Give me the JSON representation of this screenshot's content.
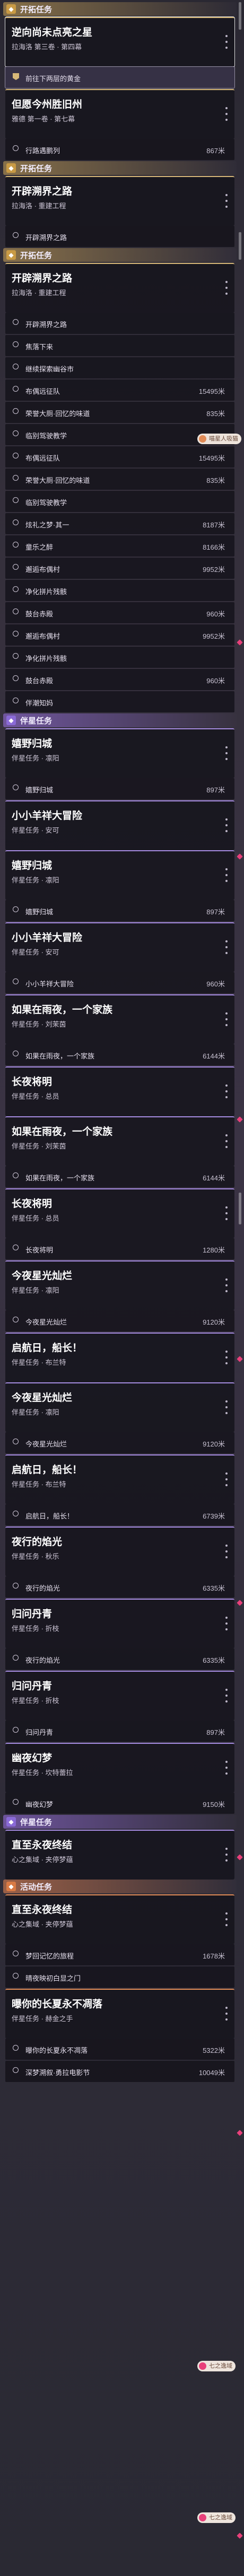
{
  "ui": {
    "more_icon": "more-vertical-icon",
    "bullet_icon": "circle-outline-icon",
    "flag_icon": "quest-flag-icon",
    "accent_colors": {
      "trailblaze": "#d7b878",
      "companion": "#a58be0",
      "event": "#e08a55",
      "marker": "#e8407a"
    }
  },
  "floating_tags": [
    {
      "label": "喵星人吸猫",
      "variant": "orange"
    },
    {
      "label": "七之逸域",
      "variant": "pink"
    },
    {
      "label": "七之逸域",
      "variant": "pink"
    }
  ],
  "feed": [
    {
      "kind": "header",
      "cat": "trail",
      "label": "开拓任务"
    },
    {
      "kind": "card",
      "cat": "trail",
      "title": "逆向尚未点亮之星",
      "sub": "拉海洛 第三卷 · 第四幕"
    },
    {
      "kind": "step",
      "text": "前往下两层的黄金",
      "dist": "",
      "bullet": "flag",
      "hl": true
    },
    {
      "kind": "card",
      "cat": "trail",
      "title": "但愿今州胜旧州",
      "sub": "雅德 第一卷 · 第七幕"
    },
    {
      "kind": "step",
      "text": "行路遇鹏列",
      "dist": "867米"
    },
    {
      "kind": "header",
      "cat": "trail",
      "label": "开拓任务"
    },
    {
      "kind": "card",
      "cat": "trail",
      "title": "开辟溯界之路",
      "sub": "拉海洛 · 重建工程"
    },
    {
      "kind": "step",
      "text": "开辟溯界之路",
      "dist": ""
    },
    {
      "kind": "header",
      "cat": "trail",
      "label": "开拓任务"
    },
    {
      "kind": "card",
      "cat": "trail",
      "title": "开辟溯界之路",
      "sub": "拉海洛 · 重建工程"
    },
    {
      "kind": "step",
      "text": "开辟溯界之路",
      "dist": ""
    },
    {
      "kind": "step",
      "text": "焦落下来",
      "dist": ""
    },
    {
      "kind": "step",
      "text": "继续探索幽谷市",
      "dist": ""
    },
    {
      "kind": "step",
      "text": "布偶远征队",
      "dist": "15495米"
    },
    {
      "kind": "step",
      "text": "荣誉大厕·回忆的味道",
      "dist": "835米"
    },
    {
      "kind": "step",
      "text": "临别驾驶教学",
      "dist": ""
    },
    {
      "kind": "step",
      "text": "布偶远征队",
      "dist": "15495米"
    },
    {
      "kind": "step",
      "text": "荣誉大厕·回忆的味道",
      "dist": "835米"
    },
    {
      "kind": "step",
      "text": "临别驾驶教学",
      "dist": ""
    },
    {
      "kind": "step",
      "text": "炫礼之梦·其一",
      "dist": "8187米"
    },
    {
      "kind": "step",
      "text": "童乐之醉",
      "dist": "8166米"
    },
    {
      "kind": "step",
      "text": "邂逅布偶村",
      "dist": "9952米"
    },
    {
      "kind": "step",
      "text": "净化拼片残骸",
      "dist": ""
    },
    {
      "kind": "step",
      "text": "鼓台赤殿",
      "dist": "960米"
    },
    {
      "kind": "step",
      "text": "邂逅布偶村",
      "dist": "9952米"
    },
    {
      "kind": "step",
      "text": "净化拼片残骸",
      "dist": ""
    },
    {
      "kind": "step",
      "text": "鼓台赤殿",
      "dist": "960米"
    },
    {
      "kind": "step",
      "text": "伴潮知妈",
      "dist": ""
    },
    {
      "kind": "header",
      "cat": "companion",
      "label": "伴星任务"
    },
    {
      "kind": "card",
      "cat": "companion",
      "title": "嬉野归城",
      "sub": "伴星任务 · 凛阳"
    },
    {
      "kind": "step",
      "text": "嬉野归城",
      "dist": "897米"
    },
    {
      "kind": "card",
      "cat": "companion",
      "title": "小小羊祥大冒险",
      "sub": "伴星任务 · 安可"
    },
    {
      "kind": "card",
      "cat": "companion",
      "title": "嬉野归城",
      "sub": "伴星任务 · 凛阳"
    },
    {
      "kind": "step",
      "text": "嬉野归城",
      "dist": "897米"
    },
    {
      "kind": "card",
      "cat": "companion",
      "title": "小小羊祥大冒险",
      "sub": "伴星任务 · 安可"
    },
    {
      "kind": "step",
      "text": "小小羊祥大冒险",
      "dist": "960米"
    },
    {
      "kind": "card",
      "cat": "companion",
      "title": "如果在雨夜，一个家族",
      "sub": "伴星任务 · 刘茉茵"
    },
    {
      "kind": "step",
      "text": "如果在雨夜，一个家族",
      "dist": "6144米"
    },
    {
      "kind": "card",
      "cat": "companion",
      "title": "长夜将明",
      "sub": "伴星任务 · 总员"
    },
    {
      "kind": "card",
      "cat": "companion",
      "title": "如果在雨夜，一个家族",
      "sub": "伴星任务 · 刘茉茵"
    },
    {
      "kind": "step",
      "text": "如果在雨夜，一个家族",
      "dist": "6144米"
    },
    {
      "kind": "card",
      "cat": "companion",
      "title": "长夜将明",
      "sub": "伴星任务 · 总员"
    },
    {
      "kind": "step",
      "text": "长夜将明",
      "dist": "1280米"
    },
    {
      "kind": "card",
      "cat": "companion",
      "title": "今夜星光灿烂",
      "sub": "伴星任务 · 凛阳"
    },
    {
      "kind": "step",
      "text": "今夜星光灿烂",
      "dist": "9120米"
    },
    {
      "kind": "card",
      "cat": "companion",
      "title": "启航日，船长！",
      "sub": "伴星任务 · 布兰特"
    },
    {
      "kind": "card",
      "cat": "companion",
      "title": "今夜星光灿烂",
      "sub": "伴星任务 · 凛阳"
    },
    {
      "kind": "step",
      "text": "今夜星光灿烂",
      "dist": "9120米"
    },
    {
      "kind": "card",
      "cat": "companion",
      "title": "启航日，船长！",
      "sub": "伴星任务 · 布兰特"
    },
    {
      "kind": "step",
      "text": "启航日，船长！",
      "dist": "6739米"
    },
    {
      "kind": "card",
      "cat": "companion",
      "title": "夜行的焰光",
      "sub": "伴星任务 · 秋乐"
    },
    {
      "kind": "step",
      "text": "夜行的焰光",
      "dist": "6335米"
    },
    {
      "kind": "card",
      "cat": "companion",
      "title": "归问丹青",
      "sub": "伴星任务 · 折枝"
    },
    {
      "kind": "step",
      "text": "夜行的焰光",
      "dist": "6335米"
    },
    {
      "kind": "card",
      "cat": "companion",
      "title": "归问丹青",
      "sub": "伴星任务 · 折枝"
    },
    {
      "kind": "step",
      "text": "归问丹青",
      "dist": "897米"
    },
    {
      "kind": "card",
      "cat": "companion",
      "title": "幽夜幻梦",
      "sub": "伴星任务 · 坎特蕾拉"
    },
    {
      "kind": "step",
      "text": "幽夜幻梦",
      "dist": "9150米"
    },
    {
      "kind": "header",
      "cat": "companion",
      "label": "伴星任务"
    },
    {
      "kind": "card",
      "cat": "companion",
      "title": "直至永夜终结",
      "sub": "心之集域 · 夹停梦蕴"
    },
    {
      "kind": "header",
      "cat": "event",
      "label": "活动任务"
    },
    {
      "kind": "card",
      "cat": "event",
      "title": "直至永夜终结",
      "sub": "心之集域 · 夹停梦蕴"
    },
    {
      "kind": "step",
      "text": "梦回记忆的旅程",
      "dist": "1678米"
    },
    {
      "kind": "step",
      "text": "晴夜映初白显之门",
      "dist": ""
    },
    {
      "kind": "card",
      "cat": "event",
      "title": "曝你的长夏永不凋落",
      "sub": "伴星任务 · 赫金之手"
    },
    {
      "kind": "step",
      "text": "曝你的长夏永不凋落",
      "dist": "5322米"
    },
    {
      "kind": "step",
      "text": "深梦溯叙·勇拉电影节",
      "dist": "10049米"
    }
  ]
}
